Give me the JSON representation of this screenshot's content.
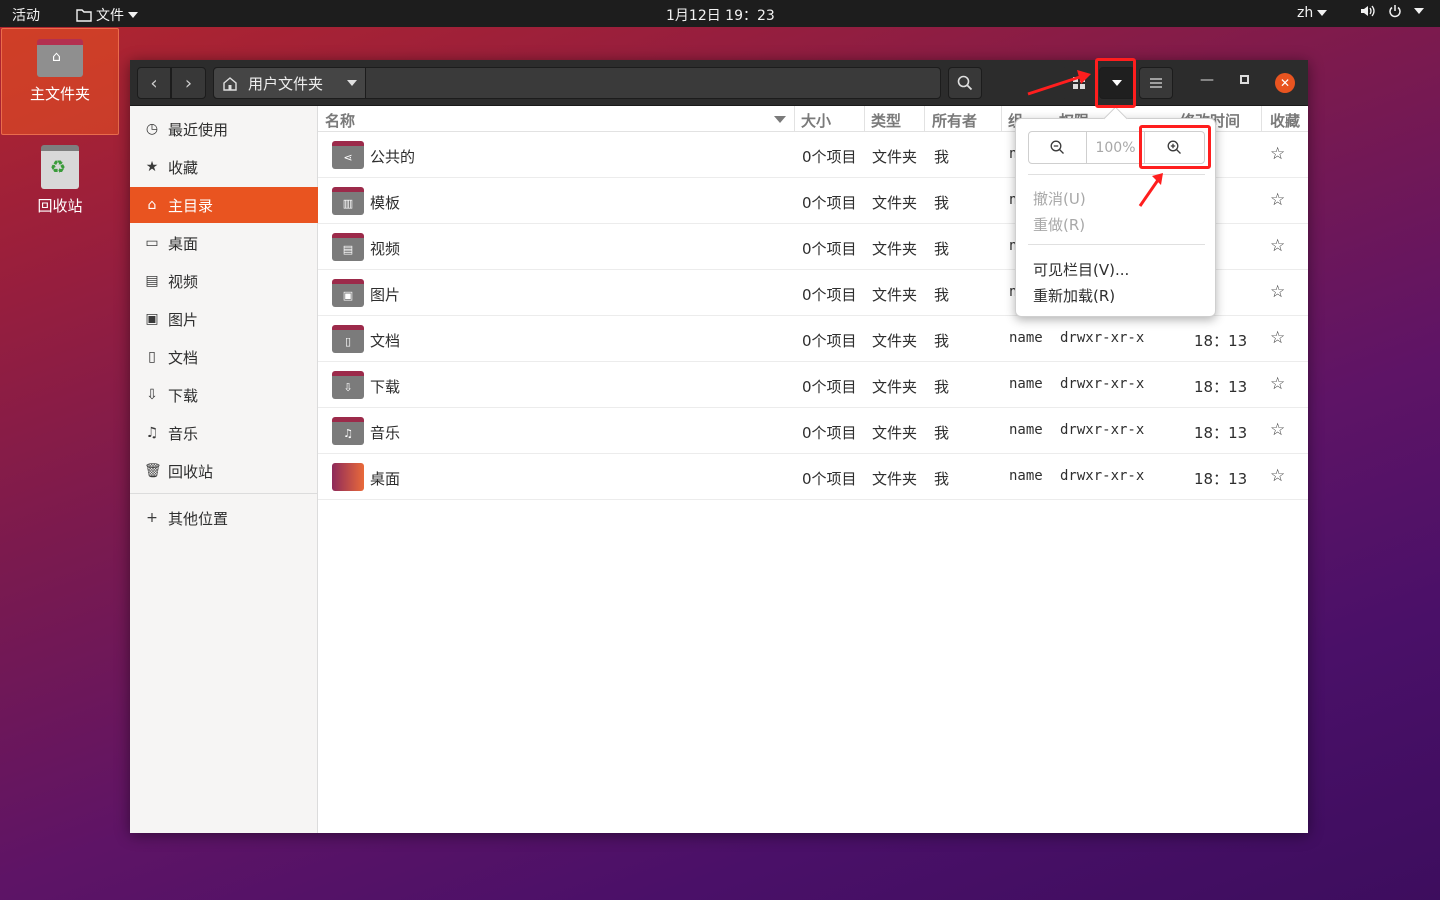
{
  "topbar": {
    "activities": "活动",
    "app_menu": "文件",
    "clock": "1月12日  19：23",
    "lang": "zh"
  },
  "desktop": {
    "home_label": "主文件夹",
    "trash_label": "回收站"
  },
  "headerbar": {
    "path": "用户文件夹"
  },
  "sidebar": {
    "items": [
      {
        "label": "最近使用",
        "icon": "clock-icon"
      },
      {
        "label": "收藏",
        "icon": "star-icon"
      },
      {
        "label": "主目录",
        "icon": "home-icon"
      },
      {
        "label": "桌面",
        "icon": "desktop-icon"
      },
      {
        "label": "视频",
        "icon": "film-icon"
      },
      {
        "label": "图片",
        "icon": "image-icon"
      },
      {
        "label": "文档",
        "icon": "document-icon"
      },
      {
        "label": "下载",
        "icon": "download-icon"
      },
      {
        "label": "音乐",
        "icon": "music-icon"
      },
      {
        "label": "回收站",
        "icon": "trash-icon"
      }
    ],
    "other_locations": "其他位置"
  },
  "columns": {
    "name": "名称",
    "size": "大小",
    "type": "类型",
    "owner": "所有者",
    "group": "组",
    "perm": "权限",
    "mtime": "修改时间",
    "starred": "收藏"
  },
  "rows": [
    {
      "name": "公共的",
      "size": "0个项目",
      "type": "文件夹",
      "owner": "我",
      "group": "n",
      "perm": "",
      "mtime": "13"
    },
    {
      "name": "模板",
      "size": "0个项目",
      "type": "文件夹",
      "owner": "我",
      "group": "n",
      "perm": "",
      "mtime": "13"
    },
    {
      "name": "视频",
      "size": "0个项目",
      "type": "文件夹",
      "owner": "我",
      "group": "n",
      "perm": "",
      "mtime": "13"
    },
    {
      "name": "图片",
      "size": "0个项目",
      "type": "文件夹",
      "owner": "我",
      "group": "n",
      "perm": "",
      "mtime": "13"
    },
    {
      "name": "文档",
      "size": "0个项目",
      "type": "文件夹",
      "owner": "我",
      "group": "name",
      "perm": "drwxr-xr-x",
      "mtime": "18：13"
    },
    {
      "name": "下载",
      "size": "0个项目",
      "type": "文件夹",
      "owner": "我",
      "group": "name",
      "perm": "drwxr-xr-x",
      "mtime": "18：13"
    },
    {
      "name": "音乐",
      "size": "0个项目",
      "type": "文件夹",
      "owner": "我",
      "group": "name",
      "perm": "drwxr-xr-x",
      "mtime": "18：13"
    },
    {
      "name": "桌面",
      "size": "0个项目",
      "type": "文件夹",
      "owner": "我",
      "group": "name",
      "perm": "drwxr-xr-x",
      "mtime": "18：13"
    }
  ],
  "popover": {
    "zoom_level": "100%",
    "undo": "撤消(U)",
    "redo": "重做(R)",
    "visible_columns": "可见栏目(V)...",
    "reload": "重新加载(R)"
  },
  "colors": {
    "accent": "#e95420",
    "annotation": "#ff1e1e"
  }
}
